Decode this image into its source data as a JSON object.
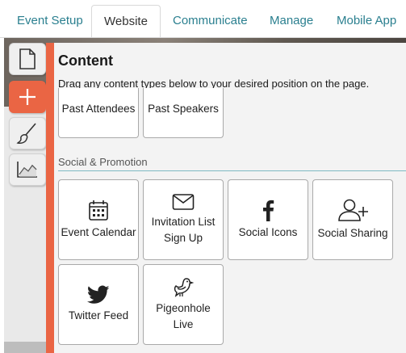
{
  "tabs": [
    {
      "label": "Event Setup"
    },
    {
      "label": "Website"
    },
    {
      "label": "Communicate"
    },
    {
      "label": "Manage"
    },
    {
      "label": "Mobile App"
    }
  ],
  "active_tab": "Website",
  "toolbar": {
    "items": [
      {
        "icon": "page-icon",
        "active": false
      },
      {
        "icon": "plus-icon",
        "active": true
      },
      {
        "icon": "brush-icon",
        "active": false
      },
      {
        "icon": "chart-icon",
        "active": false
      }
    ]
  },
  "panel": {
    "title": "Content",
    "description": "Drag any content types below to your desired position on the page.",
    "top_items": [
      {
        "label": "Past Attendees"
      },
      {
        "label": "Past Speakers"
      }
    ],
    "section_label": "Social & Promotion",
    "social_items": [
      {
        "label": "Event Calendar",
        "icon": "calendar-icon"
      },
      {
        "label_line1": "Invitation List",
        "label_line2": "Sign Up",
        "icon": "envelope-icon"
      },
      {
        "label": "Social Icons",
        "icon": "facebook-icon"
      },
      {
        "label": "Social Sharing",
        "icon": "add-user-icon"
      },
      {
        "label": "Twitter Feed",
        "icon": "twitter-icon"
      },
      {
        "label_line1": "Pigeonhole",
        "label_line2": "Live",
        "icon": "pigeon-icon"
      }
    ]
  },
  "colors": {
    "accent": "#ea6544",
    "link": "#2a7f8f"
  }
}
